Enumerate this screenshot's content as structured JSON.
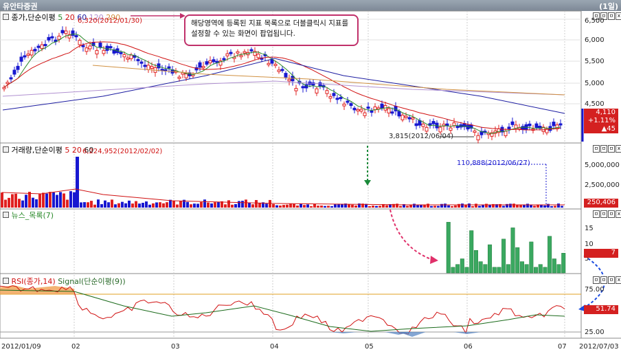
{
  "window": {
    "title": "유안타증권",
    "period": "(1일)"
  },
  "window_buttons": [
    "ㅁ",
    "ㅁ",
    "ㅁ",
    "x"
  ],
  "price_pane": {
    "title": "종가,단순이평",
    "ma_labels": [
      {
        "text": "5",
        "color": "#2a8a2a"
      },
      {
        "text": "20",
        "color": "#d01010"
      },
      {
        "text": "60",
        "color": "#1a1aa0"
      },
      {
        "text": "120",
        "color": "#b090d0"
      },
      {
        "text": "290",
        "color": "#d09040"
      }
    ],
    "high_label": "6,320(2012/01/30)",
    "low_label": "3,815(2012/06/04)",
    "y_ticks": [
      "6,500",
      "6,000",
      "5,500",
      "5,000",
      "4,500"
    ],
    "current_price": "4,110",
    "change_pct": "+1.11%",
    "change_abs": "▲45"
  },
  "volume_pane": {
    "title": "거래량,단순이평",
    "ma_labels": [
      {
        "text": "5",
        "color": "#d01010"
      },
      {
        "text": "20",
        "color": "#d01010"
      },
      {
        "text": "60",
        "color": "#222222"
      }
    ],
    "max_label": "6,224,952(2012/02/02)",
    "min_label": "110,888(2012/06/27)",
    "y_ticks": [
      "5,000,000",
      "2,500,000"
    ],
    "current_value": "250,406"
  },
  "news_pane": {
    "title": "뉴스_목록(7)",
    "y_ticks": [
      "15",
      "10",
      "5"
    ],
    "current_value": "7"
  },
  "rsi_pane": {
    "title": "RSI(종가,14)",
    "signal_title": "Signal(단순이평(9))",
    "y_ticks": [
      "75.00",
      "25.00"
    ],
    "current_value": "51.74"
  },
  "callout": {
    "text": "해당영역에 등록된 지표 목록으로 더블클릭시 지표를 설정할 수 있는 화면이 팝업됩니다."
  },
  "x_axis": {
    "labels": [
      "2012/01/09",
      "02",
      "03",
      "04",
      "05",
      "06",
      "07",
      "2012/07/03"
    ]
  },
  "colors": {
    "up": "#e02020",
    "down": "#1818d0",
    "accent": "#c0306a",
    "tag": "#d42020",
    "news_bar": "#3aa860"
  }
}
